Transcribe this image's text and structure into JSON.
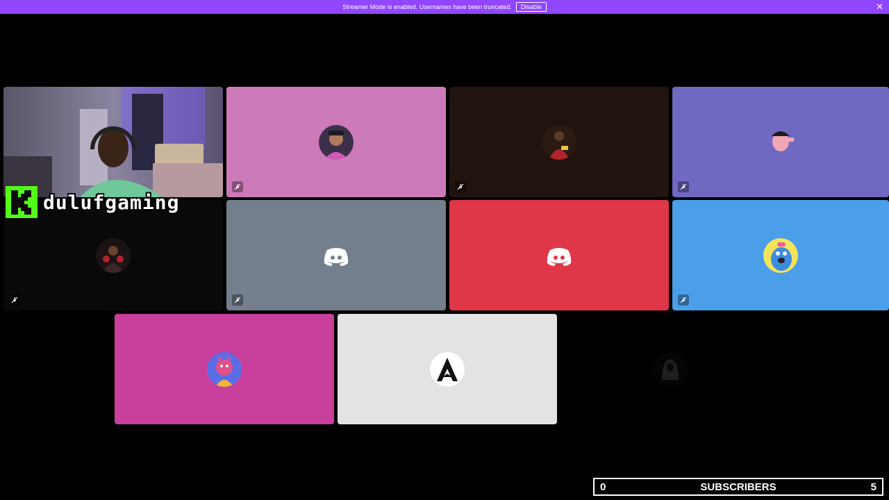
{
  "banner": {
    "message": "Streamer Mode is enabled. Usernames have been truncated.",
    "disable_label": "Disable",
    "close_glyph": "✕",
    "color": "#9146ff"
  },
  "overlay": {
    "streamer_name": "dulufgaming",
    "logo": "kick-logo",
    "logo_color": "#53fc18"
  },
  "tiles": [
    {
      "kind": "camera",
      "bg": "#2a2830",
      "muted": false
    },
    {
      "kind": "avatar",
      "bg": "#cd7ab9",
      "avatar": "person-avatar",
      "muted": true
    },
    {
      "kind": "avatar",
      "bg": "#21130e",
      "avatar": "soccer-player-avatar",
      "muted": true
    },
    {
      "kind": "avatar",
      "bg": "#6f69c1",
      "avatar": "cartoon-avatar",
      "muted": true
    },
    {
      "kind": "avatar",
      "bg": "#090909",
      "avatar": "boxer-avatar",
      "muted": true
    },
    {
      "kind": "avatar",
      "bg": "#747f8d",
      "avatar": "discord-default-avatar",
      "muted": true
    },
    {
      "kind": "avatar",
      "bg": "#df3747",
      "avatar": "discord-default-avatar",
      "muted": false
    },
    {
      "kind": "avatar",
      "bg": "#4b9ee8",
      "avatar": "blue-creature-avatar",
      "muted": true
    },
    {
      "kind": "avatar",
      "bg": "#c8409b",
      "avatar": "devil-cartoon-avatar",
      "muted": false
    },
    {
      "kind": "avatar",
      "bg": "#e3e3e3",
      "avatar": "assassins-creed-avatar",
      "muted": false
    },
    {
      "kind": "avatar",
      "bg": "#000000",
      "avatar": "hooded-figure-avatar",
      "muted": false
    }
  ],
  "subscribers": {
    "current": "0",
    "label": "SUBSCRIBERS",
    "goal": "5"
  }
}
